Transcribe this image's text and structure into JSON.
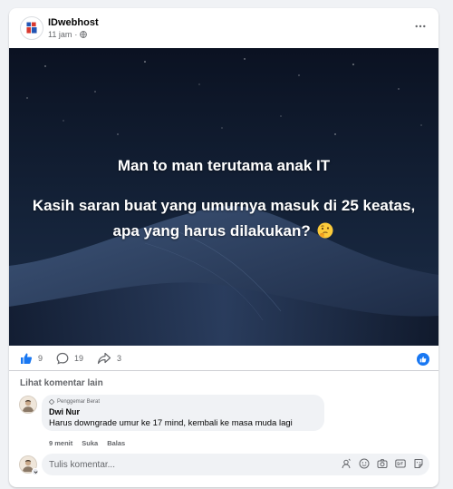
{
  "post": {
    "page_name": "IDwebhost",
    "timestamp": "11 jam",
    "separator": "·",
    "headline": "Man to man terutama anak IT",
    "body": "Kasih saran buat yang umurnya masuk di 25 keatas, apa yang harus dilakukan?",
    "body_emoji": "thinking-face-icon"
  },
  "stats": {
    "likes": "9",
    "comments": "19",
    "shares": "3"
  },
  "comments": {
    "view_more_label": "Lihat komentar lain",
    "items": [
      {
        "badge": "Penggemar Berat",
        "name": "Dwi Nur",
        "text": "Harus downgrade umur ke 17 mind, kembali ke masa muda lagi",
        "time": "9 menit",
        "like_label": "Suka",
        "reply_label": "Balas"
      }
    ]
  },
  "composer": {
    "placeholder": "Tulis komentar..."
  },
  "colors": {
    "accent": "#1877f2",
    "muted_text": "#65676b",
    "bubble_bg": "#f0f2f5",
    "image_bg": "#0d1526"
  }
}
